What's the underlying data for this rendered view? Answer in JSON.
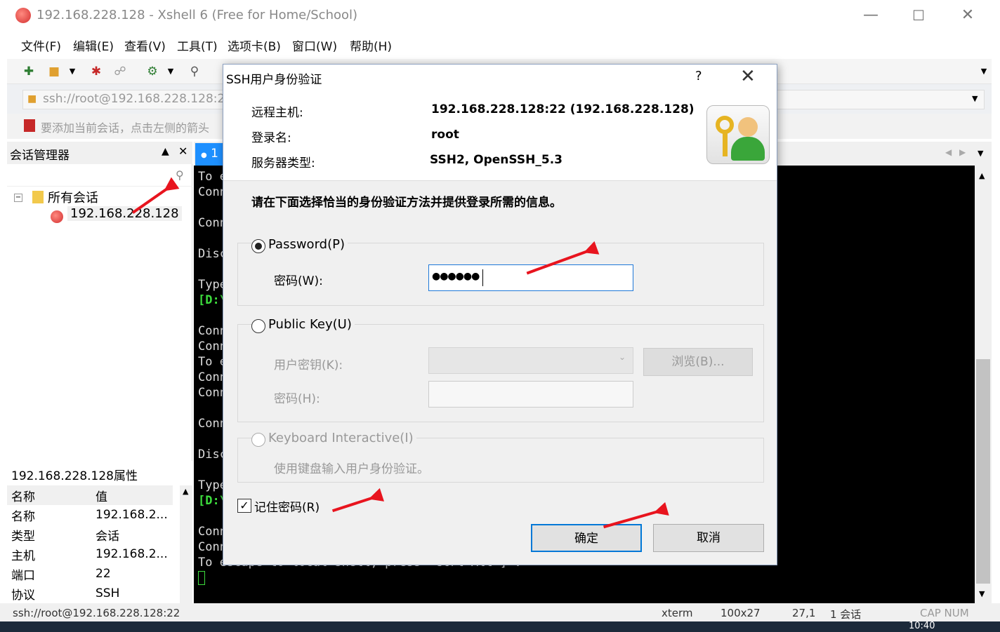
{
  "window": {
    "title": "192.168.228.128 - Xshell 6 (Free for Home/School)"
  },
  "menu": [
    "文件(F)",
    "编辑(E)",
    "查看(V)",
    "工具(T)",
    "选项卡(B)",
    "窗口(W)",
    "帮助(H)"
  ],
  "address": {
    "value": "ssh://root@192.168.228.128:2"
  },
  "tip": {
    "text": "要添加当前会话，点击左侧的箭头"
  },
  "session_manager": {
    "title": "会话管理器",
    "tree_root": "所有会话",
    "tree_child": "192.168.228.128"
  },
  "properties": {
    "title": "192.168.228.128属性",
    "headers": [
      "名称",
      "值"
    ],
    "rows": [
      [
        "名称",
        "192.168.2..."
      ],
      [
        "类型",
        "会话"
      ],
      [
        "主机",
        "192.168.2..."
      ],
      [
        "端口",
        "22"
      ],
      [
        "协议",
        "SSH"
      ]
    ]
  },
  "tab": {
    "label": "1"
  },
  "terminal_lines": [
    "To e",
    "Conn",
    "",
    "Conn",
    "",
    "Disc",
    "",
    "Type",
    "[D:\\",
    "",
    "Conn",
    "Conn",
    "To e",
    "Conn",
    "Conn",
    "",
    "Conn",
    "",
    "Disc",
    "",
    "Type",
    "[D:\\",
    "",
    "Conn",
    "Conn",
    "To escape to local shell, press 'Ctrl+Alt+]'."
  ],
  "dialog": {
    "title": "SSH用户身份验证",
    "help": "?",
    "remote_host_label": "远程主机:",
    "remote_host_value": "192.168.228.128:22 (192.168.228.128)",
    "login_label": "登录名:",
    "login_value": "root",
    "server_type_label": "服务器类型:",
    "server_type_value": "SSH2, OpenSSH_5.3",
    "instruction": "请在下面选择恰当的身份验证方法并提供登录所需的信息。",
    "password_option": "Password(P)",
    "password_label": "密码(W):",
    "password_value": "●●●●●●",
    "pubkey_option": "Public Key(U)",
    "user_key_label": "用户密钥(K):",
    "browse_button": "浏览(B)...",
    "passphrase_label": "密码(H):",
    "keyboard_option": "Keyboard Interactive(I)",
    "keyboard_desc": "使用键盘输入用户身份验证。",
    "remember_label": "记住密码(R)",
    "ok_button": "确定",
    "cancel_button": "取消"
  },
  "status": {
    "path": "ssh://root@192.168.228.128:22",
    "term": "xterm",
    "size": "100x27",
    "pos": "27,1",
    "sessions": "1 会话",
    "caps": "CAP NUM"
  },
  "taskbar": {
    "clock": "10:40"
  },
  "colors": {
    "accent": "#0078d7",
    "tab_active": "#1e90ff",
    "arrow": "#e8141e"
  }
}
